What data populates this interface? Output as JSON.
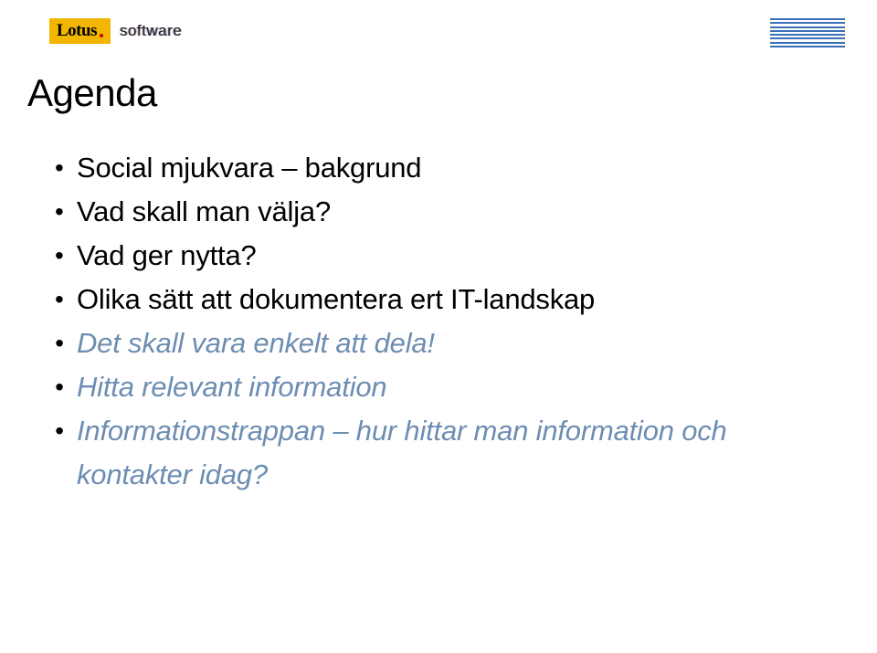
{
  "header": {
    "lotus_label": "Lotus",
    "software_label": "software",
    "ibm_alt": "IBM"
  },
  "title": "Agenda",
  "bullets": [
    {
      "text": "Social mjukvara – bakgrund",
      "style": "black"
    },
    {
      "text": "Vad skall man välja?",
      "style": "black"
    },
    {
      "text": "Vad ger nytta?",
      "style": "black"
    },
    {
      "text": "Olika sätt att dokumentera ert IT-landskap",
      "style": "black"
    },
    {
      "text": "Det skall vara enkelt att dela!",
      "style": "blue"
    },
    {
      "text": "Hitta relevant information",
      "style": "blue"
    },
    {
      "text": "Informationstrappan – hur hittar man information och kontakter idag?",
      "style": "blue"
    }
  ]
}
